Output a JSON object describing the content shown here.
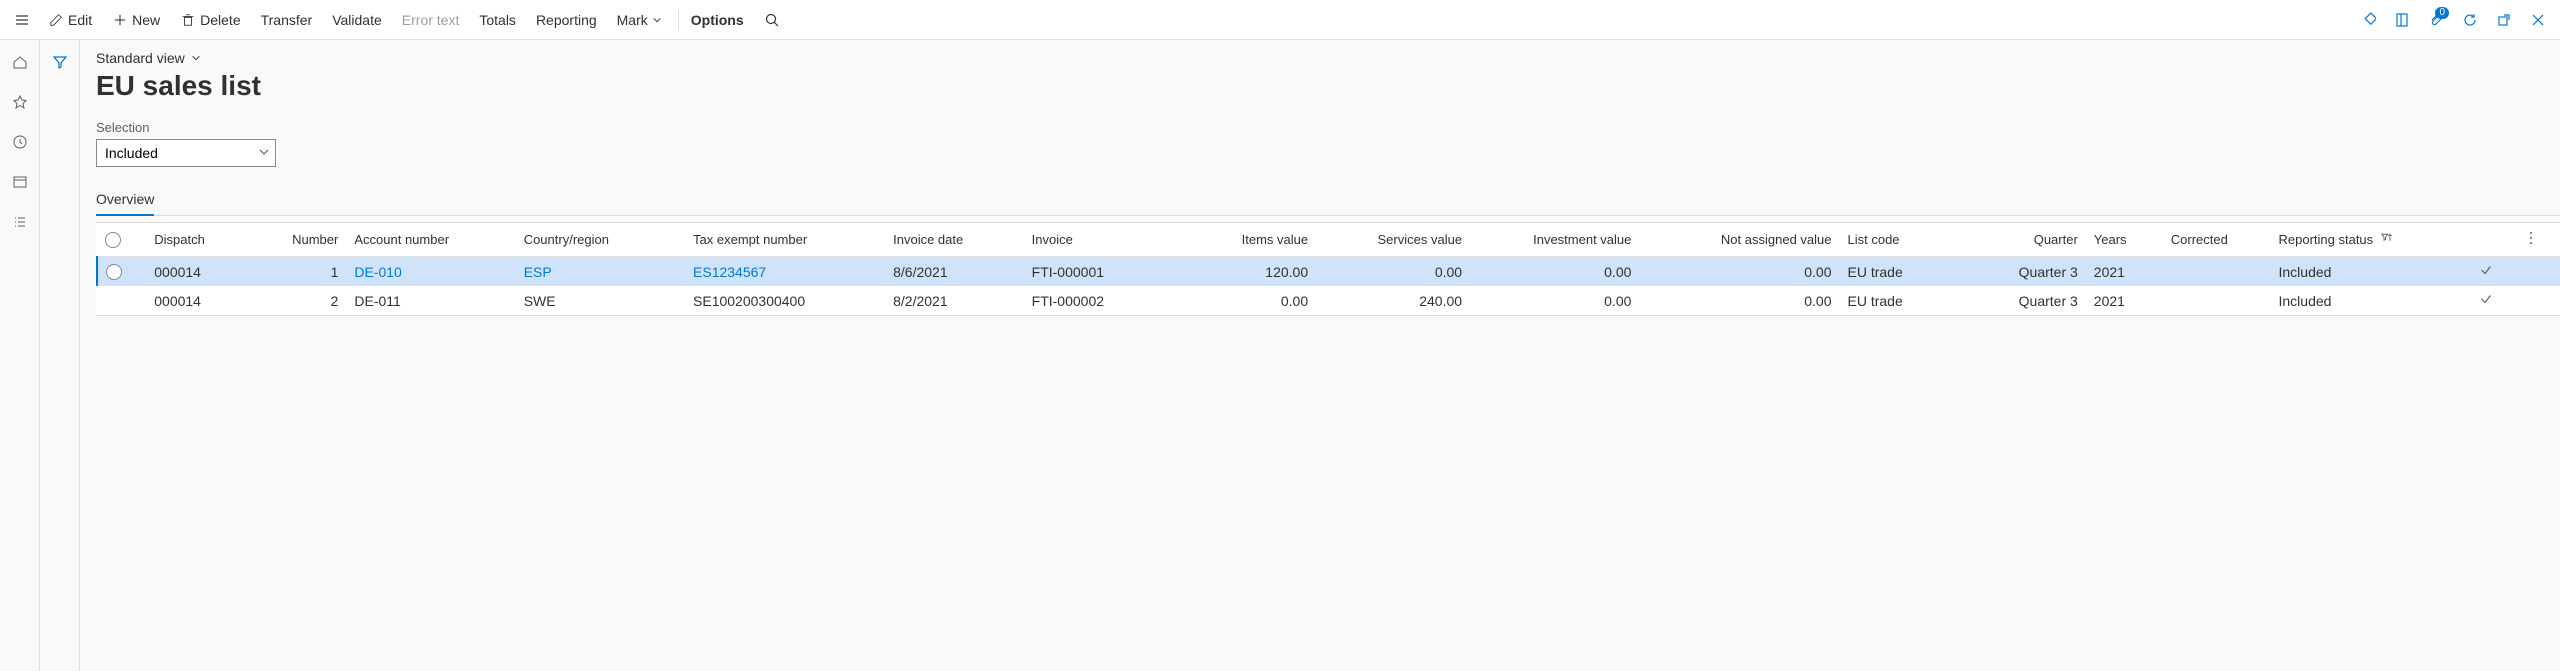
{
  "toolbar": {
    "edit": "Edit",
    "new": "New",
    "delete": "Delete",
    "transfer": "Transfer",
    "validate": "Validate",
    "error_text": "Error text",
    "totals": "Totals",
    "reporting": "Reporting",
    "mark": "Mark",
    "options": "Options",
    "attachments_count": "0"
  },
  "header": {
    "view_selector": "Standard view",
    "page_title": "EU sales list"
  },
  "filter": {
    "selection_label": "Selection",
    "selection_value": "Included"
  },
  "tabs": {
    "overview": "Overview"
  },
  "grid": {
    "columns": {
      "dispatch": "Dispatch",
      "number": "Number",
      "account_number": "Account number",
      "country_region": "Country/region",
      "tax_exempt_number": "Tax exempt number",
      "invoice_date": "Invoice date",
      "invoice": "Invoice",
      "items_value": "Items value",
      "services_value": "Services value",
      "investment_value": "Investment value",
      "not_assigned_value": "Not assigned value",
      "list_code": "List code",
      "quarter": "Quarter",
      "years": "Years",
      "corrected": "Corrected",
      "reporting_status": "Reporting status"
    },
    "rows": [
      {
        "dispatch": "000014",
        "number": "1",
        "account_number": "DE-010",
        "country_region": "ESP",
        "tax_exempt_number": "ES1234567",
        "invoice_date": "8/6/2021",
        "invoice": "FTI-000001",
        "items_value": "120.00",
        "services_value": "0.00",
        "investment_value": "0.00",
        "not_assigned_value": "0.00",
        "list_code": "EU trade",
        "quarter": "Quarter 3",
        "years": "2021",
        "reporting_status": "Included",
        "selected": true
      },
      {
        "dispatch": "000014",
        "number": "2",
        "account_number": "DE-011",
        "country_region": "SWE",
        "tax_exempt_number": "SE100200300400",
        "invoice_date": "8/2/2021",
        "invoice": "FTI-000002",
        "items_value": "0.00",
        "services_value": "240.00",
        "investment_value": "0.00",
        "not_assigned_value": "0.00",
        "list_code": "EU trade",
        "quarter": "Quarter 3",
        "years": "2021",
        "reporting_status": "Included",
        "selected": false
      }
    ]
  }
}
